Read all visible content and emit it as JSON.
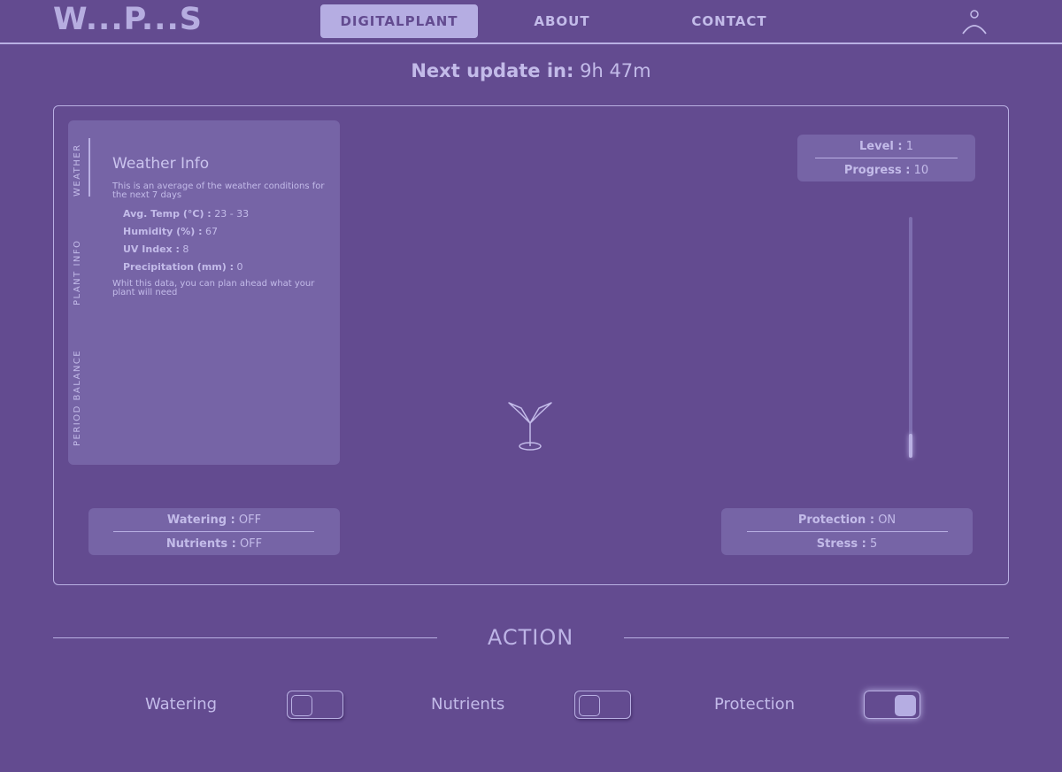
{
  "header": {
    "logo": "W...P...S",
    "nav": [
      "DIGITALPLANT",
      "ABOUT",
      "CONTACT"
    ],
    "active_nav": "DIGITALPLANT",
    "user_icon": "user-icon"
  },
  "update": {
    "label": "Next update in:",
    "value": "9h 47m"
  },
  "side_tabs": [
    "WEATHER",
    "PLANT INFO",
    "PERIOD BALANCE"
  ],
  "weather": {
    "title": "Weather Info",
    "description": "This is an average of the weather conditions for the next 7 days",
    "rows": [
      {
        "label": "Avg. Temp (°C) :",
        "value": "23 - 33"
      },
      {
        "label": "Humidity (%) :",
        "value": "67"
      },
      {
        "label": "UV Index :",
        "value": "8"
      },
      {
        "label": "Precipitation (mm) :",
        "value": "0"
      }
    ],
    "footer": "Whit this data, you can plan ahead what your plant will need"
  },
  "level_box": {
    "level_label": "Level :",
    "level_value": "1",
    "progress_label": "Progress :",
    "progress_value": "10"
  },
  "progress_bar": {
    "percent": 10
  },
  "care_box": {
    "watering_label": "Watering :",
    "watering_value": "OFF",
    "nutrients_label": "Nutrients :",
    "nutrients_value": "OFF"
  },
  "protection_box": {
    "protection_label": "Protection :",
    "protection_value": "ON",
    "stress_label": "Stress :",
    "stress_value": "5"
  },
  "action": {
    "title": "ACTION",
    "toggles": [
      {
        "label": "Watering",
        "on": false
      },
      {
        "label": "Nutrients",
        "on": false
      },
      {
        "label": "Protection",
        "on": true
      }
    ]
  },
  "colors": {
    "background": "#634b90",
    "panel": "#7664a6",
    "accent": "#b5ade2",
    "text": "#c3bbe9"
  }
}
